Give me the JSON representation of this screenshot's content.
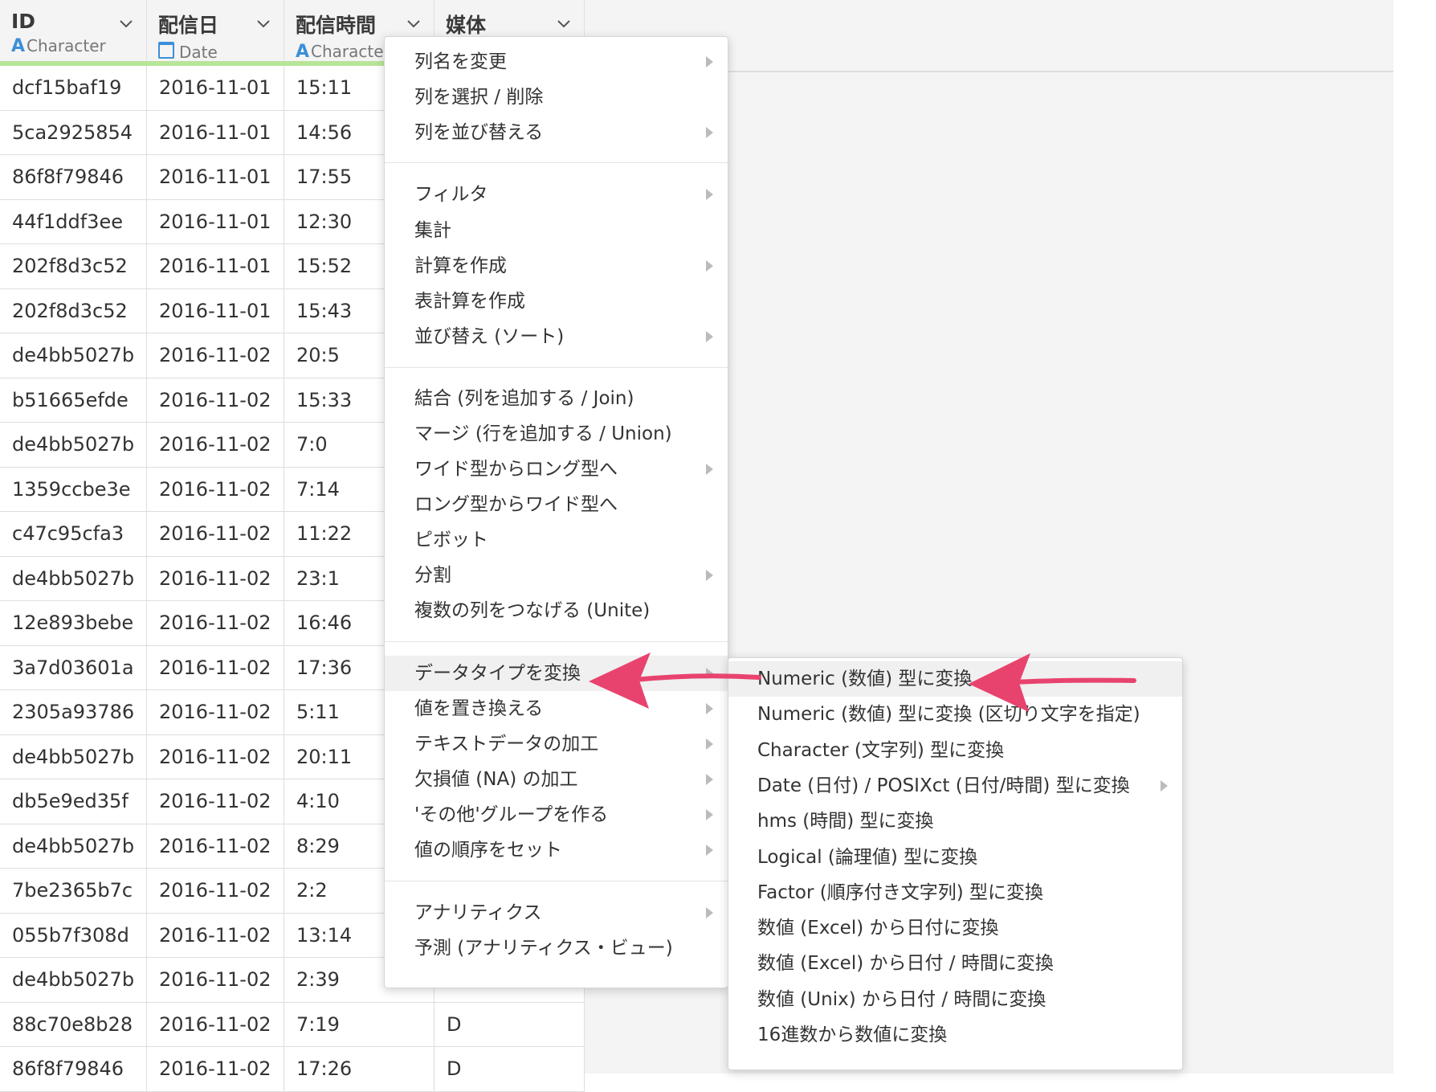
{
  "columns": [
    {
      "name": "ID",
      "type": "Character",
      "type_icon": "A"
    },
    {
      "name": "配信日",
      "type": "Date",
      "type_icon": "calendar-icon"
    },
    {
      "name": "配信時間",
      "type": "Characte",
      "type_icon": "A"
    },
    {
      "name": "媒体",
      "type": "",
      "type_icon": ""
    }
  ],
  "rows": [
    [
      "dcf15baf19",
      "2016-11-01",
      "15:11",
      ""
    ],
    [
      "5ca2925854",
      "2016-11-01",
      "14:56",
      ""
    ],
    [
      "86f8f79846",
      "2016-11-01",
      "17:55",
      ""
    ],
    [
      "44f1ddf3ee",
      "2016-11-01",
      "12:30",
      ""
    ],
    [
      "202f8d3c52",
      "2016-11-01",
      "15:52",
      ""
    ],
    [
      "202f8d3c52",
      "2016-11-01",
      "15:43",
      ""
    ],
    [
      "de4bb5027b",
      "2016-11-02",
      "20:5",
      ""
    ],
    [
      "b51665efde",
      "2016-11-02",
      "15:33",
      ""
    ],
    [
      "de4bb5027b",
      "2016-11-02",
      "7:0",
      ""
    ],
    [
      "1359ccbe3e",
      "2016-11-02",
      "7:14",
      ""
    ],
    [
      "c47c95cfa3",
      "2016-11-02",
      "11:22",
      ""
    ],
    [
      "de4bb5027b",
      "2016-11-02",
      "23:1",
      ""
    ],
    [
      "12e893bebe",
      "2016-11-02",
      "16:46",
      ""
    ],
    [
      "3a7d03601a",
      "2016-11-02",
      "17:36",
      ""
    ],
    [
      "2305a93786",
      "2016-11-02",
      "5:11",
      ""
    ],
    [
      "de4bb5027b",
      "2016-11-02",
      "20:11",
      ""
    ],
    [
      "db5e9ed35f",
      "2016-11-02",
      "4:10",
      ""
    ],
    [
      "de4bb5027b",
      "2016-11-02",
      "8:29",
      ""
    ],
    [
      "7be2365b7c",
      "2016-11-02",
      "2:2",
      ""
    ],
    [
      "055b7f308d",
      "2016-11-02",
      "13:14",
      ""
    ],
    [
      "de4bb5027b",
      "2016-11-02",
      "2:39",
      ""
    ],
    [
      "88c70e8b28",
      "2016-11-02",
      "7:19",
      "D"
    ],
    [
      "86f8f79846",
      "2016-11-02",
      "17:26",
      "D"
    ]
  ],
  "context_menu": {
    "items": [
      {
        "label": "列名を変更",
        "submenu": true
      },
      {
        "label": "列を選択 / 削除",
        "submenu": false
      },
      {
        "label": "列を並び替える",
        "submenu": true
      },
      {
        "label": "フィルタ",
        "submenu": true
      },
      {
        "label": "集計",
        "submenu": false
      },
      {
        "label": "計算を作成",
        "submenu": true
      },
      {
        "label": "表計算を作成",
        "submenu": false
      },
      {
        "label": "並び替え (ソート)",
        "submenu": true
      },
      {
        "label": "結合 (列を追加する / Join)",
        "submenu": false
      },
      {
        "label": "マージ (行を追加する / Union)",
        "submenu": false
      },
      {
        "label": "ワイド型からロング型へ",
        "submenu": true
      },
      {
        "label": "ロング型からワイド型へ",
        "submenu": false
      },
      {
        "label": "ピボット",
        "submenu": false
      },
      {
        "label": "分割",
        "submenu": true
      },
      {
        "label": "複数の列をつなげる (Unite)",
        "submenu": false
      },
      {
        "label": "データタイプを変換",
        "submenu": true,
        "highlighted": true
      },
      {
        "label": "値を置き換える",
        "submenu": true
      },
      {
        "label": "テキストデータの加工",
        "submenu": true
      },
      {
        "label": "欠損値 (NA) の加工",
        "submenu": true
      },
      {
        "label": "'その他'グループを作る",
        "submenu": true
      },
      {
        "label": "値の順序をセット",
        "submenu": true
      },
      {
        "label": "アナリティクス",
        "submenu": true
      },
      {
        "label": "予測 (アナリティクス・ビュー)",
        "submenu": false
      }
    ]
  },
  "submenu": {
    "items": [
      {
        "label": "Numeric (数値) 型に変換",
        "submenu": false,
        "highlighted": true
      },
      {
        "label": "Numeric (数値) 型に変換 (区切り文字を指定)",
        "submenu": false
      },
      {
        "label": "Character (文字列) 型に変換",
        "submenu": false
      },
      {
        "label": "Date (日付) / POSIXct (日付/時間) 型に変換",
        "submenu": true
      },
      {
        "label": "hms (時間) 型に変換",
        "submenu": false
      },
      {
        "label": "Logical (論理値) 型に変換",
        "submenu": false
      },
      {
        "label": "Factor (順序付き文字列) 型に変換",
        "submenu": false
      },
      {
        "label": "数値 (Excel) から日付に変換",
        "submenu": false
      },
      {
        "label": "数値 (Excel) から日付 / 時間に変換",
        "submenu": false
      },
      {
        "label": "数値 (Unix) から日付 / 時間に変換",
        "submenu": false
      },
      {
        "label": "16進数から数値に変換",
        "submenu": false
      }
    ]
  },
  "colors": {
    "header_bg": "#f4f4f4",
    "header_accent": "#b8e598",
    "type_icon": "#3b8fd8",
    "annotation_arrow": "#e8436e",
    "menu_highlight": "#f0f0f0"
  }
}
